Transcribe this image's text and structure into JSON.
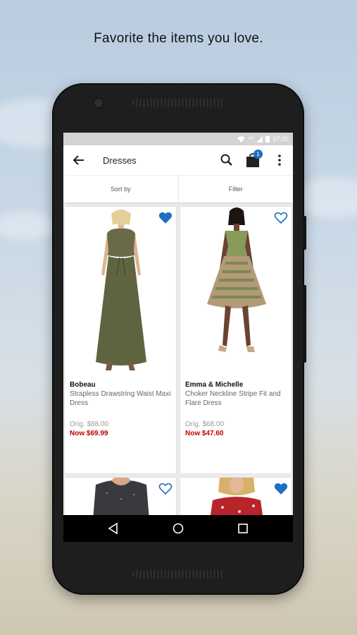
{
  "headline": "Favorite the items you love.",
  "status_bar": {
    "time": "07:00",
    "network": "4G"
  },
  "toolbar": {
    "title": "Dresses",
    "bag_count": "1"
  },
  "sort_filter": {
    "sort_label": "Sort by",
    "filter_label": "Filter"
  },
  "products": [
    {
      "brand": "Bobeau",
      "name": "Strapless Drawstring Waist Maxi Dress",
      "orig_price": "Orig. $88.00",
      "now_price": "Now $69.99",
      "favorited": true
    },
    {
      "brand": "Emma & Michelle",
      "name": "Choker Neckline Stripe Fit and Flare Dress",
      "orig_price": "Orig. $68.00",
      "now_price": "Now $47.60",
      "favorited": false
    },
    {
      "brand": "",
      "name": "",
      "orig_price": "",
      "now_price": "",
      "favorited": false
    },
    {
      "brand": "",
      "name": "",
      "orig_price": "",
      "now_price": "",
      "favorited": true
    }
  ],
  "colors": {
    "accent": "#1f6fc2",
    "sale_price": "#c00000"
  }
}
